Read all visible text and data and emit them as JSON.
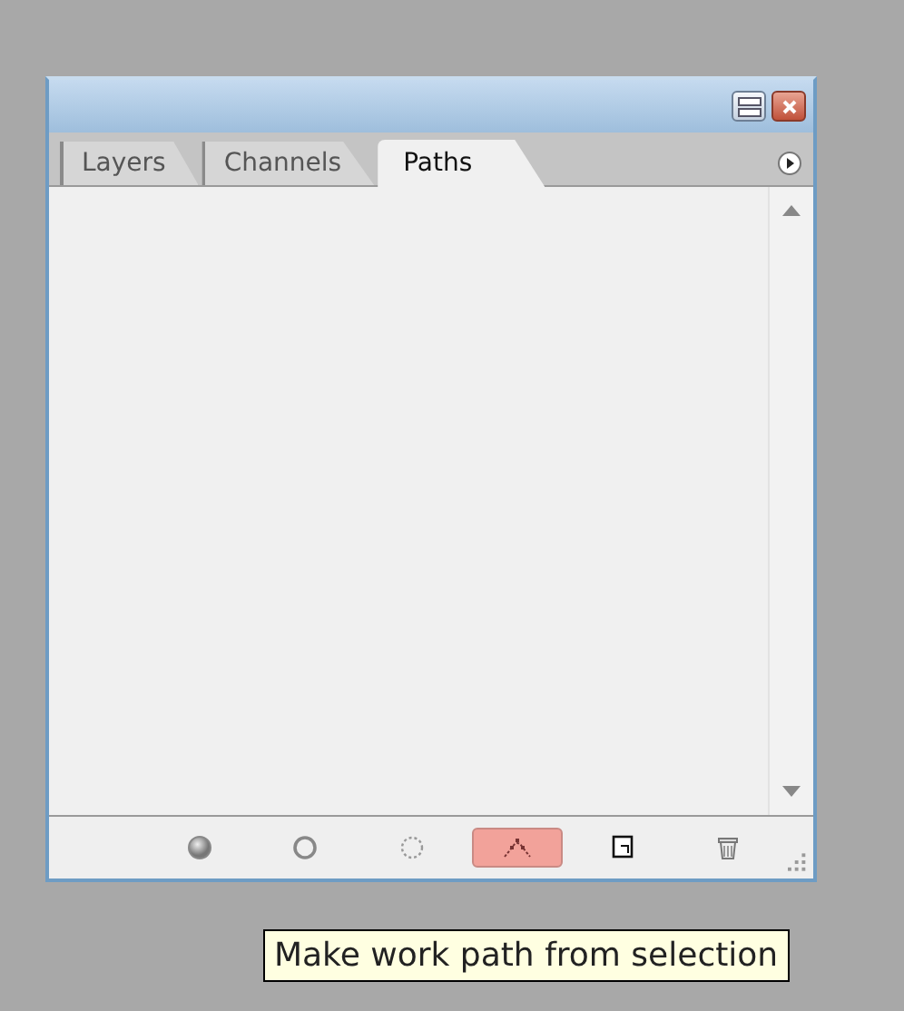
{
  "panel": {
    "tabs": [
      {
        "label": "Layers",
        "selected": false
      },
      {
        "label": "Channels",
        "selected": false
      },
      {
        "label": "Paths",
        "selected": true
      }
    ],
    "toolbar": [
      {
        "kind": "fill",
        "highlighted": false
      },
      {
        "kind": "stroke",
        "highlighted": false
      },
      {
        "kind": "selection",
        "highlighted": false
      },
      {
        "kind": "workpath",
        "highlighted": true
      },
      {
        "kind": "newpath",
        "highlighted": false
      },
      {
        "kind": "delete",
        "highlighted": false
      }
    ]
  },
  "tooltip": {
    "text": "Make work path from selection"
  }
}
